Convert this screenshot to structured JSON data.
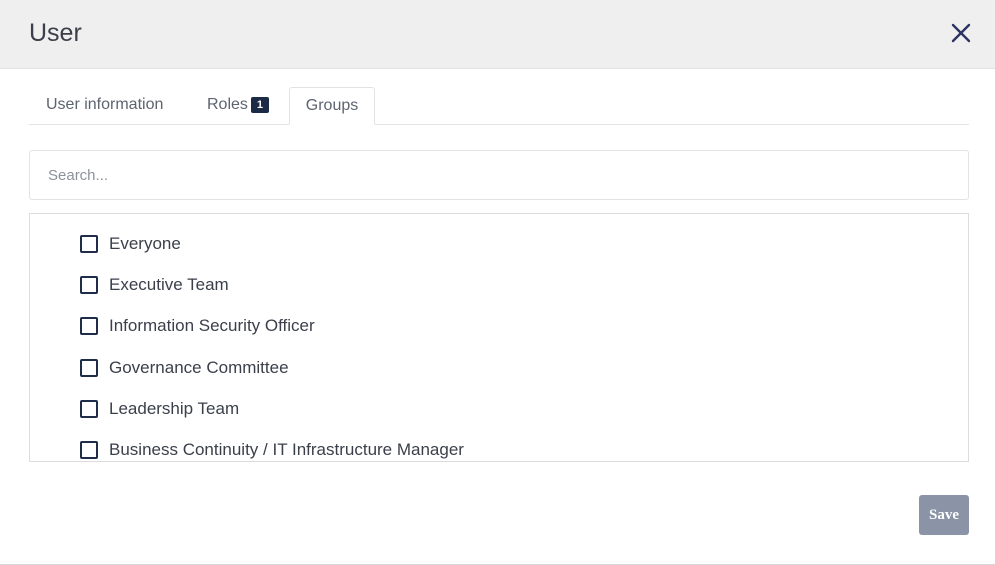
{
  "dialog": {
    "title": "User",
    "close_icon": "close-icon"
  },
  "tabs": [
    {
      "label": "User information",
      "active": false
    },
    {
      "label": "Roles",
      "badge": "1",
      "active": false
    },
    {
      "label": "Groups",
      "active": true
    }
  ],
  "search": {
    "placeholder": "Search...",
    "value": ""
  },
  "groups": [
    {
      "label": "Everyone",
      "checked": false
    },
    {
      "label": "Executive Team",
      "checked": false
    },
    {
      "label": "Information Security Officer",
      "checked": false
    },
    {
      "label": "Governance Committee",
      "checked": false
    },
    {
      "label": "Leadership Team",
      "checked": false
    },
    {
      "label": "Business Continuity / IT Infrastructure Manager",
      "checked": false
    }
  ],
  "footer": {
    "save_label": "Save"
  },
  "colors": {
    "header_bg": "#efefef",
    "accent": "#1b2a45",
    "save_bg": "#8a94a6"
  }
}
